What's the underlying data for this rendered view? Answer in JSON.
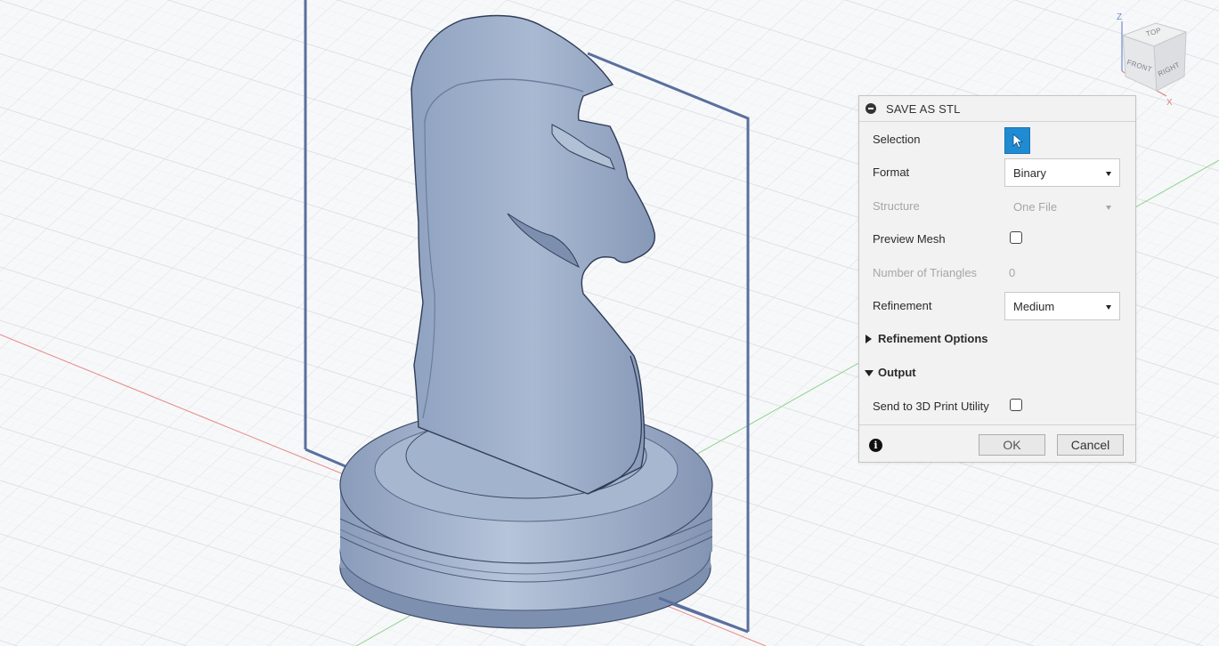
{
  "viewcube": {
    "faces": {
      "front": "FRONT",
      "right": "RIGHT",
      "top": "TOP"
    },
    "axes": {
      "z": "Z",
      "x": "X"
    }
  },
  "model": {
    "name": "chess knight"
  },
  "dialog": {
    "title": "SAVE AS STL",
    "rows": {
      "selection": {
        "label": "Selection"
      },
      "format": {
        "label": "Format",
        "value": "Binary"
      },
      "structure": {
        "label": "Structure",
        "value": "One File"
      },
      "preview_mesh": {
        "label": "Preview Mesh",
        "checked": false
      },
      "num_triangles": {
        "label": "Number of Triangles",
        "value": "0"
      },
      "refinement": {
        "label": "Refinement",
        "value": "Medium"
      }
    },
    "sections": {
      "refinement_options": {
        "label": "Refinement Options",
        "expanded": false
      },
      "output": {
        "label": "Output",
        "expanded": true
      }
    },
    "output": {
      "send_to_print": {
        "label": "Send to 3D Print Utility",
        "checked": false
      }
    },
    "buttons": {
      "ok": "OK",
      "cancel": "Cancel"
    }
  },
  "colors": {
    "model_fill": "#9fb1cc",
    "model_edge": "#3b4a66",
    "sketch_plane": "#5a6f9e",
    "x_axis": "#e06b6b",
    "y_axis": "#6bc46b",
    "selection_accent": "#1f8bd2"
  }
}
